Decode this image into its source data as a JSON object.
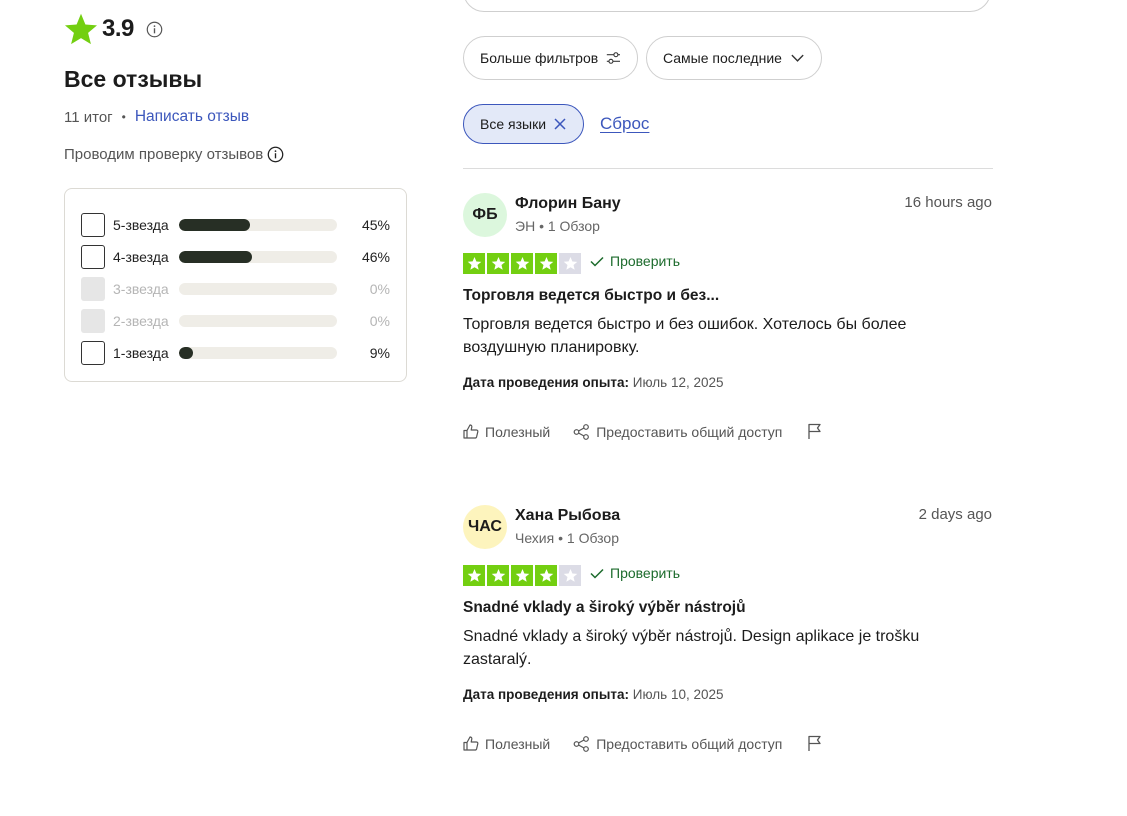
{
  "summary": {
    "rating": "3.9",
    "title": "Все отзывы",
    "total": "11 итог",
    "dot": "•",
    "write_review": "Написать отзыв",
    "verification": "Проводим проверку отзывов",
    "accent_color": "#73cf11"
  },
  "distribution": [
    {
      "label": "5-звезда",
      "pct_text": "45%",
      "fraction": 0.45,
      "enabled": true
    },
    {
      "label": "4-звезда",
      "pct_text": "46%",
      "fraction": 0.46,
      "enabled": true
    },
    {
      "label": "3-звезда",
      "pct_text": "0%",
      "fraction": 0,
      "enabled": false
    },
    {
      "label": "2-звезда",
      "pct_text": "0%",
      "fraction": 0,
      "enabled": false
    },
    {
      "label": "1-звезда",
      "pct_text": "9%",
      "fraction": 0.09,
      "enabled": true
    }
  ],
  "filters": {
    "more_filters": "Больше фильтров",
    "sort": "Самые последние",
    "language_chip": "Все языки",
    "reset": "Сброс"
  },
  "reviews": [
    {
      "initials": "ФБ",
      "avatar_color": "#dcf7dd",
      "author": "Флорин Бану",
      "meta": "ЭН • 1 Обзор",
      "time": "16 hours ago",
      "stars": 4,
      "verified": "Проверить",
      "title": "Торговля ведется быстро и без...",
      "body": "Торговля ведется быстро и без ошибок. Хотелось бы более воздушную планировку.",
      "date_label": "Дата проведения опыта:",
      "date_value": "Июль 12, 2025",
      "useful": "Полезный",
      "share": "Предоставить общий доступ"
    },
    {
      "initials": "ЧАС",
      "avatar_color": "#fdf4bd",
      "author": "Хана Рыбова",
      "meta": "Чехия • 1 Обзор",
      "time": "2 days ago",
      "stars": 4,
      "verified": "Проверить",
      "title": "Snadné vklady a široký výběr nástrojů",
      "body": "Snadné vklady a široký výběr nástrojů. Design aplikace je trošku zastaralý.",
      "date_label": "Дата проведения опыта:",
      "date_value": "Июль 10, 2025",
      "useful": "Полезный",
      "share": "Предоставить общий доступ"
    }
  ]
}
